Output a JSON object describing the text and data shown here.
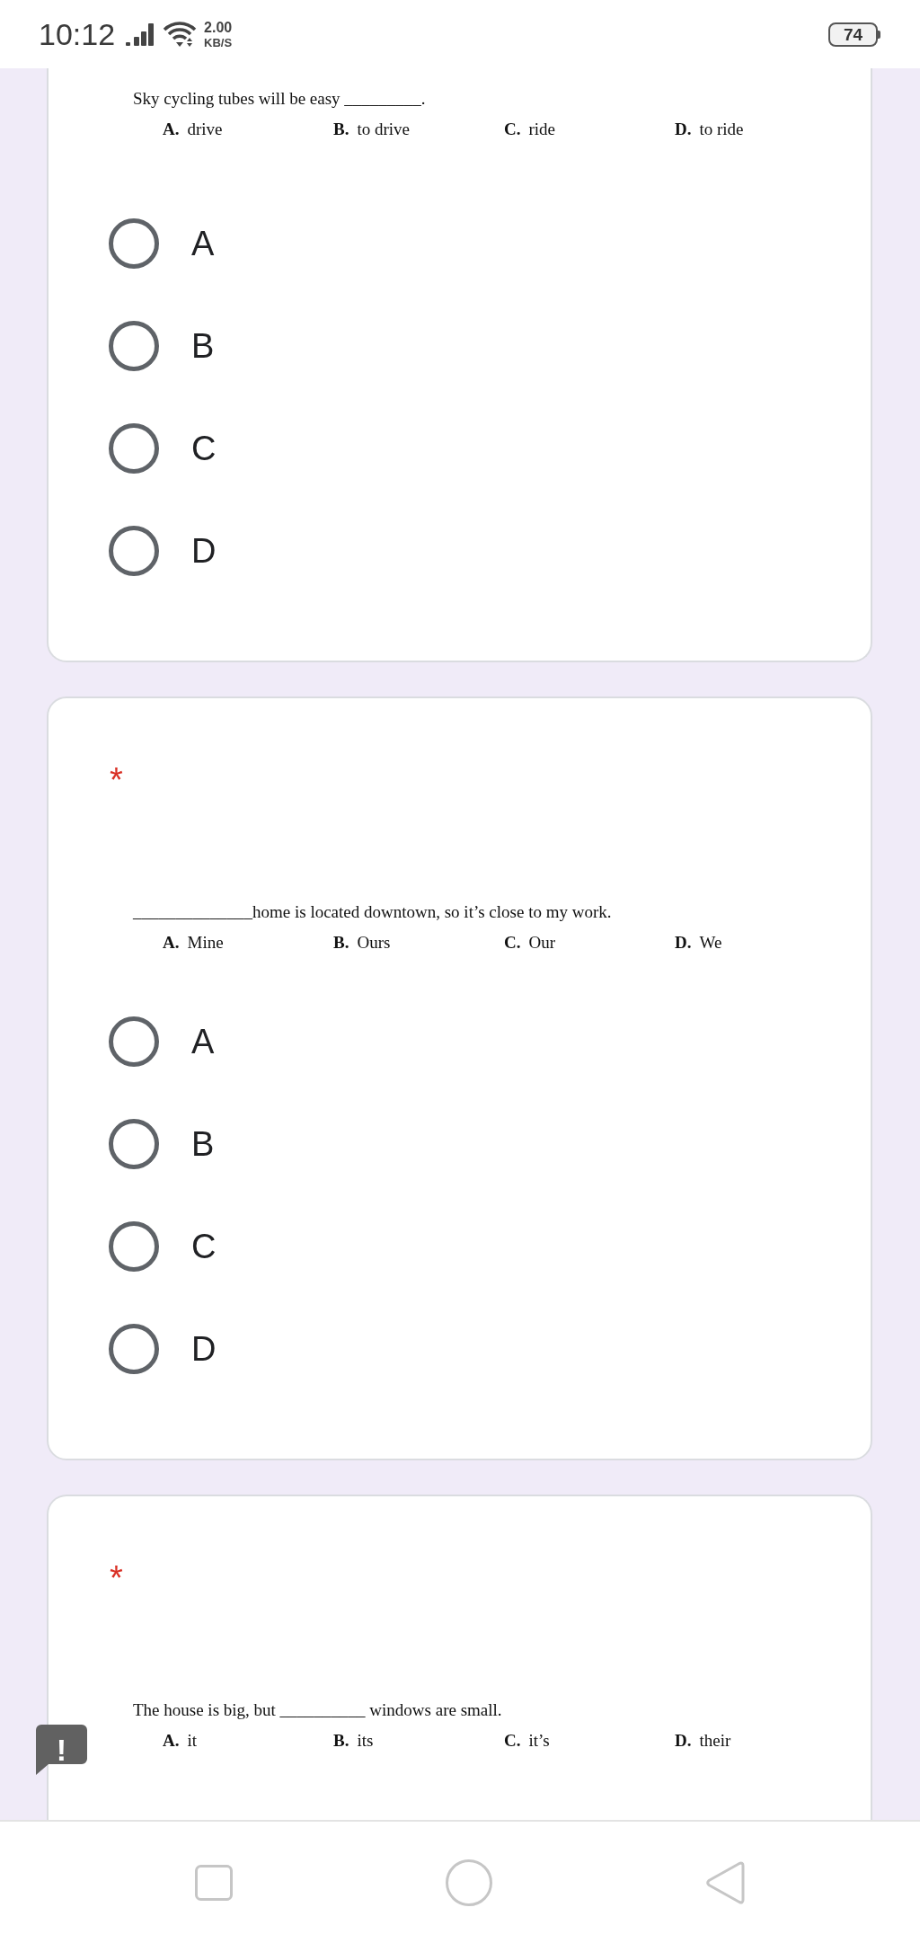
{
  "status_bar": {
    "time": "10:12",
    "network_speed": {
      "value": "2.00",
      "unit": "KB/S"
    },
    "battery": "74"
  },
  "questions": [
    {
      "question": {
        "text": "Sky cycling tubes will be easy _________.",
        "options": [
          {
            "letter": "A.",
            "text": "drive"
          },
          {
            "letter": "B.",
            "text": "to drive"
          },
          {
            "letter": "C.",
            "text": "ride"
          },
          {
            "letter": "D.",
            "text": "to ride"
          }
        ]
      },
      "choices": [
        {
          "label": "A",
          "selected": false
        },
        {
          "label": "B",
          "selected": false
        },
        {
          "label": "C",
          "selected": false
        },
        {
          "label": "D",
          "selected": false
        }
      ]
    },
    {
      "required_mark": "*",
      "question": {
        "text": "______________home is located downtown, so it’s close to my work.",
        "options": [
          {
            "letter": "A.",
            "text": "Mine"
          },
          {
            "letter": "B.",
            "text": "Ours"
          },
          {
            "letter": "C.",
            "text": "Our"
          },
          {
            "letter": "D.",
            "text": "We"
          }
        ]
      },
      "choices": [
        {
          "label": "A",
          "selected": false
        },
        {
          "label": "B",
          "selected": false
        },
        {
          "label": "C",
          "selected": false
        },
        {
          "label": "D",
          "selected": false
        }
      ]
    },
    {
      "required_mark": "*",
      "question": {
        "text": "The house is big, but __________ windows are small.",
        "options": [
          {
            "letter": "A.",
            "text": "it"
          },
          {
            "letter": "B.",
            "text": "its"
          },
          {
            "letter": "C.",
            "text": "it’s"
          },
          {
            "letter": "D.",
            "text": "their"
          }
        ]
      }
    }
  ],
  "feedback_button": {
    "label": "!"
  }
}
